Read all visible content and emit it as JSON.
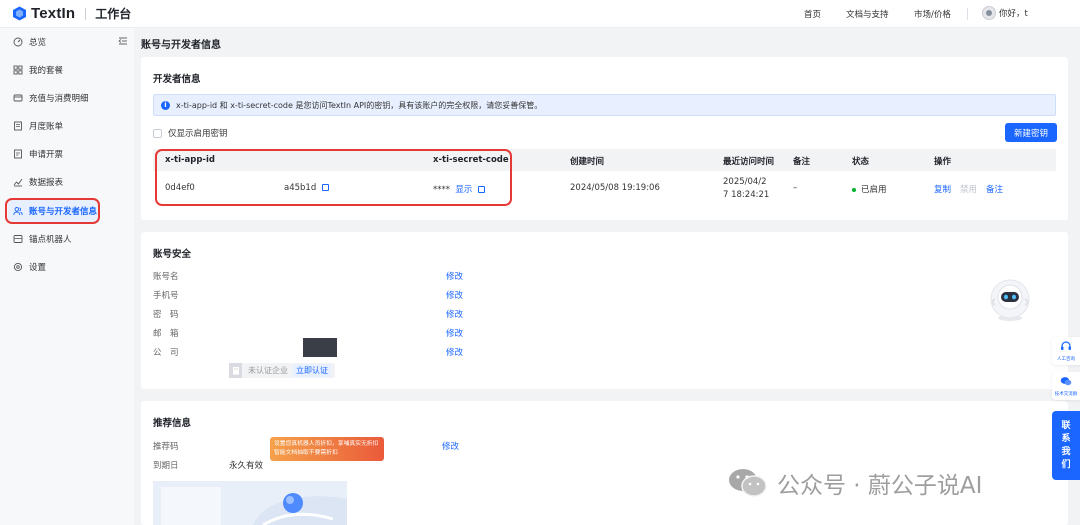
{
  "header": {
    "logo_text": "TextIn",
    "sub_title": "工作台",
    "nav": [
      "首页",
      "文档与支持",
      "市场/价格"
    ],
    "user_greeting": "你好，t"
  },
  "sidebar": {
    "items": [
      {
        "label": "总览",
        "icon": "dashboard-icon"
      },
      {
        "label": "我的套餐",
        "icon": "grid-icon"
      },
      {
        "label": "充值与消费明细",
        "icon": "recharge-icon"
      },
      {
        "label": "月度账单",
        "icon": "bill-icon"
      },
      {
        "label": "申请开票",
        "icon": "invoice-icon"
      },
      {
        "label": "数据报表",
        "icon": "chart-icon"
      },
      {
        "label": "账号与开发者信息",
        "icon": "users-icon",
        "active": true
      },
      {
        "label": "锚点机器人",
        "icon": "robot-icon"
      },
      {
        "label": "设置",
        "icon": "gear-icon"
      }
    ]
  },
  "page_title": "账号与开发者信息",
  "developer": {
    "title": "开发者信息",
    "alert": "x-ti-app-id 和 x-ti-secret-code 是您访问TextIn API的密钥，具有该账户的完全权限，请您妥善保管。",
    "checkbox_label": "仅显示启用密钥",
    "new_key_button": "新建密钥",
    "columns": [
      "x-ti-app-id",
      "x-ti-secret-code",
      "创建时间",
      "最近访问时间",
      "备注",
      "状态",
      "操作"
    ],
    "row": {
      "app_id_prefix": "0d4ef0",
      "app_id_suffix": "a45b1d",
      "secret": "****",
      "show": "显示",
      "created": "2024/05/08 19:19:06",
      "last_access_line1": "2025/04/2",
      "last_access_line2": "7 18:24:21",
      "note": "–",
      "status": "已启用",
      "status_color": "#00b42a",
      "actions": [
        "复制",
        "禁用",
        "备注"
      ]
    }
  },
  "security": {
    "title": "账号安全",
    "labels": [
      "账号名",
      "手机号",
      "密　码",
      "邮　箱",
      "公　司"
    ],
    "edit": "修改",
    "cert_status": "未认证企业",
    "cert_action": "立即认证"
  },
  "recommend": {
    "title": "推荐信息",
    "code_label": "推荐码",
    "expire_label": "到期日",
    "expire_value": "永久有效",
    "tooltip_line1": "设置您真机器人员折扣，享哺真实无折扣",
    "tooltip_line2": "智能文档抽取不要需折扣",
    "edit": "修改"
  },
  "floating": {
    "customer_service": "人工咨询",
    "tech_group": "技术交流群",
    "contact": [
      "联",
      "系",
      "我",
      "们"
    ]
  },
  "watermark": "公众号 · 蔚公子说AI",
  "colors": {
    "primary": "#1a66ff",
    "highlight_frame": "#e53935"
  }
}
